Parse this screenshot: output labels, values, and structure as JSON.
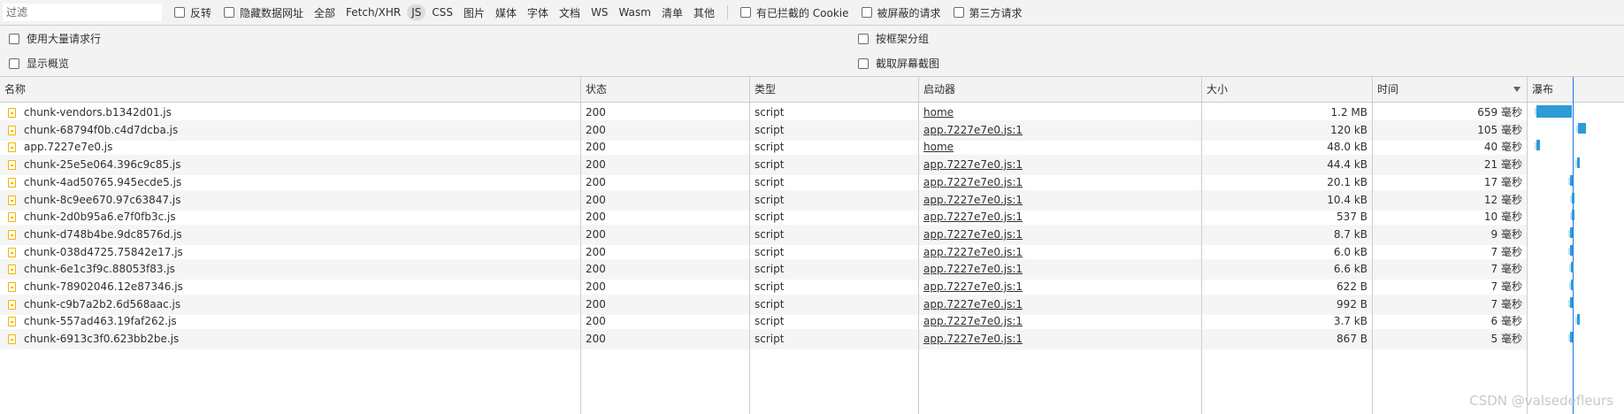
{
  "filter": {
    "placeholder": "过滤",
    "value": ""
  },
  "filterbar": {
    "invert_label": "反转",
    "hide_data_urls_label": "隐藏数据网址",
    "types": [
      "全部",
      "Fetch/XHR",
      "JS",
      "CSS",
      "图片",
      "媒体",
      "字体",
      "文档",
      "WS",
      "Wasm",
      "清单",
      "其他"
    ],
    "active_type": "JS",
    "blocked_cookies_label": "有已拦截的 Cookie",
    "blocked_requests_label": "被屏蔽的请求",
    "third_party_label": "第三方请求"
  },
  "options": {
    "large_rows": "使用大量请求行",
    "group_by_frame": "按框架分组",
    "show_overview": "显示概览",
    "capture_screenshots": "截取屏幕截图"
  },
  "columns": {
    "name": "名称",
    "status": "状态",
    "type": "类型",
    "initiator": "启动器",
    "size": "大小",
    "time": "时间",
    "waterfall": "瀑布"
  },
  "rows": [
    {
      "name": "chunk-vendors.b1342d01.js",
      "status": "200",
      "type": "script",
      "initiator": "home",
      "size": "1.2 MB",
      "time": "659 毫秒"
    },
    {
      "name": "chunk-68794f0b.c4d7dcba.js",
      "status": "200",
      "type": "script",
      "initiator": "app.7227e7e0.js:1",
      "size": "120 kB",
      "time": "105 毫秒"
    },
    {
      "name": "app.7227e7e0.js",
      "status": "200",
      "type": "script",
      "initiator": "home",
      "size": "48.0 kB",
      "time": "40 毫秒"
    },
    {
      "name": "chunk-25e5e064.396c9c85.js",
      "status": "200",
      "type": "script",
      "initiator": "app.7227e7e0.js:1",
      "size": "44.4 kB",
      "time": "21 毫秒"
    },
    {
      "name": "chunk-4ad50765.945ecde5.js",
      "status": "200",
      "type": "script",
      "initiator": "app.7227e7e0.js:1",
      "size": "20.1 kB",
      "time": "17 毫秒"
    },
    {
      "name": "chunk-8c9ee670.97c63847.js",
      "status": "200",
      "type": "script",
      "initiator": "app.7227e7e0.js:1",
      "size": "10.4 kB",
      "time": "12 毫秒"
    },
    {
      "name": "chunk-2d0b95a6.e7f0fb3c.js",
      "status": "200",
      "type": "script",
      "initiator": "app.7227e7e0.js:1",
      "size": "537 B",
      "time": "10 毫秒"
    },
    {
      "name": "chunk-d748b4be.9dc8576d.js",
      "status": "200",
      "type": "script",
      "initiator": "app.7227e7e0.js:1",
      "size": "8.7 kB",
      "time": "9 毫秒"
    },
    {
      "name": "chunk-038d4725.75842e17.js",
      "status": "200",
      "type": "script",
      "initiator": "app.7227e7e0.js:1",
      "size": "6.0 kB",
      "time": "7 毫秒"
    },
    {
      "name": "chunk-6e1c3f9c.88053f83.js",
      "status": "200",
      "type": "script",
      "initiator": "app.7227e7e0.js:1",
      "size": "6.6 kB",
      "time": "7 毫秒"
    },
    {
      "name": "chunk-78902046.12e87346.js",
      "status": "200",
      "type": "script",
      "initiator": "app.7227e7e0.js:1",
      "size": "622 B",
      "time": "7 毫秒"
    },
    {
      "name": "chunk-c9b7a2b2.6d568aac.js",
      "status": "200",
      "type": "script",
      "initiator": "app.7227e7e0.js:1",
      "size": "992 B",
      "time": "7 毫秒"
    },
    {
      "name": "chunk-557ad463.19faf262.js",
      "status": "200",
      "type": "script",
      "initiator": "app.7227e7e0.js:1",
      "size": "3.7 kB",
      "time": "6 毫秒"
    },
    {
      "name": "chunk-6913c3f0.623bb2be.js",
      "status": "200",
      "type": "script",
      "initiator": "app.7227e7e0.js:1",
      "size": "867 B",
      "time": "5 毫秒"
    }
  ],
  "watermark": "CSDN @valsedefleurs",
  "colors": {
    "accent": "#2e9bd6",
    "timeline": "#1a73e8",
    "file_icon": "#f4b400"
  }
}
